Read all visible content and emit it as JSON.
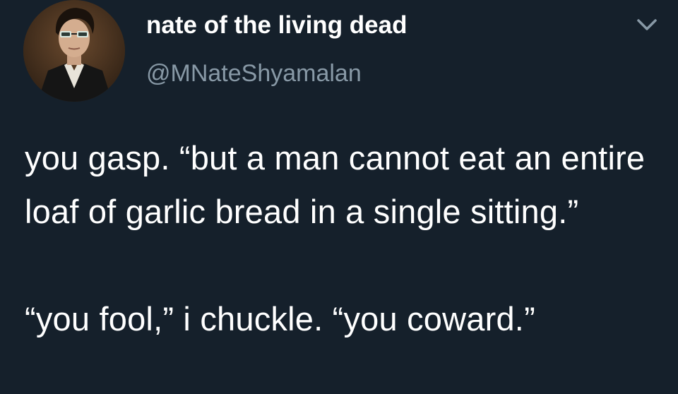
{
  "tweet": {
    "author": {
      "display_name": "nate of the living dead",
      "handle": "@MNateShyamalan",
      "avatar_icon": "portrait-avatar"
    },
    "menu_icon": "chevron-down-icon",
    "text_paragraphs": [
      "you gasp. “but a man cannot eat an entire loaf of garlic bread in a single sitting.”",
      "“you fool,” i chuckle. “you coward.”"
    ]
  },
  "theme": {
    "background": "#15202b",
    "text_primary": "#ffffff",
    "text_secondary": "#8899a6"
  }
}
